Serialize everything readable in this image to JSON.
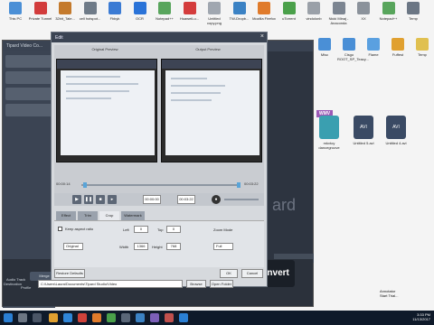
{
  "desktop": {
    "icons": [
      {
        "label": "This PC",
        "color": "#4a8fd6"
      },
      {
        "label": "Private Tunnel",
        "color": "#d23c3c"
      },
      {
        "label": "32bit_Tale...",
        "color": "#c47a2c"
      },
      {
        "label": "cell hotspot...",
        "color": "#6f7b88"
      },
      {
        "label": "Fbkyk",
        "color": "#3b7bd4"
      },
      {
        "label": "OCR",
        "color": "#2a73d8"
      },
      {
        "label": "Notepad++",
        "color": "#58a55c"
      },
      {
        "label": "HuaweiLu...",
        "color": "#d43c3c"
      },
      {
        "label": "Untitled copy.png",
        "color": "#a0a7b0"
      },
      {
        "label": "TW-Dropb...",
        "color": "#3b82c4"
      },
      {
        "label": "Mozilla Firefox",
        "color": "#e07b2b"
      },
      {
        "label": "uTorrent",
        "color": "#4aa04a"
      },
      {
        "label": "vindolonb",
        "color": "#9aa0a8"
      },
      {
        "label": "Nicki Minaj - Anaconda",
        "color": "#7c8591"
      },
      {
        "label": "XX",
        "color": "#8b929b"
      },
      {
        "label": "Notepad++",
        "color": "#58a55c"
      },
      {
        "label": "Temp",
        "color": "#6b7684"
      }
    ],
    "right_icons": [
      {
        "label": "Misc",
        "color": "#4a8fd6"
      },
      {
        "label": "Cisgo ROOT_SP_Teacy...",
        "color": "#4a8fd6"
      },
      {
        "label": "Flame",
        "color": "#5aa0e0"
      },
      {
        "label": "Fuffest",
        "color": "#e0a030"
      },
      {
        "label": "Temp",
        "color": "#e0c050"
      }
    ],
    "cards": [
      {
        "label": "mkvtoy dancegroove",
        "color": "#3a9fb0"
      },
      {
        "label": "Untitled 5.avi",
        "color": "#3a4a64"
      },
      {
        "label": "Untitled 4.avi",
        "color": "#3a4a64"
      }
    ],
    "wmv_badge": "WMV",
    "avi_badge": "AVI"
  },
  "app": {
    "title": "Tipard Video Co...",
    "merge_label": "Merge",
    "convert_label": "Convert",
    "brand_text": "ard",
    "audio_track_label": "Audio Track",
    "profile_label": "Profile",
    "destination_label": "Destination",
    "destination_value": "C:\\Users\\Laura\\Documents\\Tipard Studio\\Video",
    "browse_label": "Browse",
    "open_folder_label": "Open Folder"
  },
  "dialog": {
    "title": "Edit",
    "close_glyph": "×",
    "original_preview_label": "Original Preview",
    "output_preview_label": "Output Preview",
    "time_start": "00:00:14",
    "time_end": "00:03:22",
    "start_time_box": "00:00:00",
    "end_time_box": "00:03:22",
    "tabs": [
      {
        "label": "Effect",
        "active": false
      },
      {
        "label": "Trim",
        "active": false
      },
      {
        "label": "Crop",
        "active": true
      },
      {
        "label": "Watermark",
        "active": false
      }
    ],
    "crop": {
      "keep_aspect_label": "Keep aspect ratio",
      "aspect_value": "Original",
      "left_label": "Left",
      "left_value": "0",
      "top_label": "Top",
      "top_value": "0",
      "width_label": "Width",
      "width_value": "1366",
      "height_label": "Height",
      "height_value": "768",
      "zoom_mode_label": "Zoom Mode",
      "zoom_mode_value": "Full"
    },
    "restore_defaults_label": "Restore Defaults",
    "ok_label": "OK",
    "cancel_label": "Cancel"
  },
  "taskbar": {
    "clock_time": "3:33 PM",
    "clock_date": "11/13/2017"
  },
  "annotation": {
    "line1": "Annotator",
    "line2": "Start Trial..."
  }
}
